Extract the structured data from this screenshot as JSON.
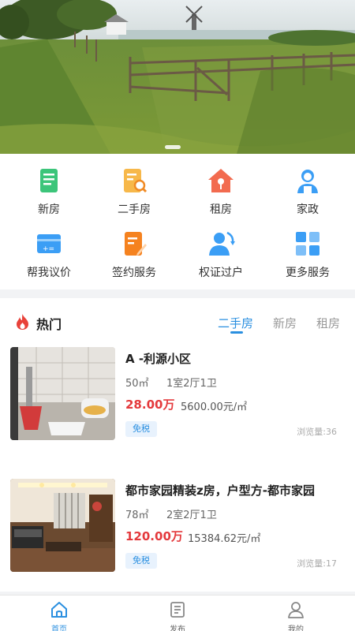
{
  "menu": {
    "items": [
      {
        "label": "新房",
        "icon": "new-house-icon",
        "color": "#3cc57a"
      },
      {
        "label": "二手房",
        "icon": "second-hand-house-icon",
        "color": "#f5a623"
      },
      {
        "label": "租房",
        "icon": "rent-house-icon",
        "color": "#f26b4f"
      },
      {
        "label": "家政",
        "icon": "housekeeping-icon",
        "color": "#3b9ef5"
      },
      {
        "label": "帮我议价",
        "icon": "negotiate-price-icon",
        "color": "#3b9ef5"
      },
      {
        "label": "签约服务",
        "icon": "contract-service-icon",
        "color": "#f5821f"
      },
      {
        "label": "权证过户",
        "icon": "title-transfer-icon",
        "color": "#3b9ef5"
      },
      {
        "label": "更多服务",
        "icon": "more-services-icon",
        "color": "#3b9ef5"
      }
    ]
  },
  "hot": {
    "title": "热门",
    "tabs": [
      "二手房",
      "新房",
      "租房"
    ],
    "active_tab": "二手房",
    "listings": [
      {
        "title": "A -利源小区",
        "area": "50㎡",
        "layout": "1室2厅1卫",
        "price": "28.00万",
        "unit_price": "5600.00元/㎡",
        "tag": "免税",
        "views": "浏览量:36"
      },
      {
        "title": "都市家园精装z房，户型方-都市家园",
        "area": "78㎡",
        "layout": "2室2厅1卫",
        "price": "120.00万",
        "unit_price": "15384.62元/㎡",
        "tag": "免税",
        "views": "浏览量:17"
      }
    ]
  },
  "tabbar": {
    "items": [
      {
        "label": "首页",
        "icon": "home-icon"
      },
      {
        "label": "发布",
        "icon": "publish-icon"
      },
      {
        "label": "我的",
        "icon": "profile-icon"
      }
    ]
  },
  "colors": {
    "accent": "#2a8fe0",
    "price": "#e4393c"
  }
}
